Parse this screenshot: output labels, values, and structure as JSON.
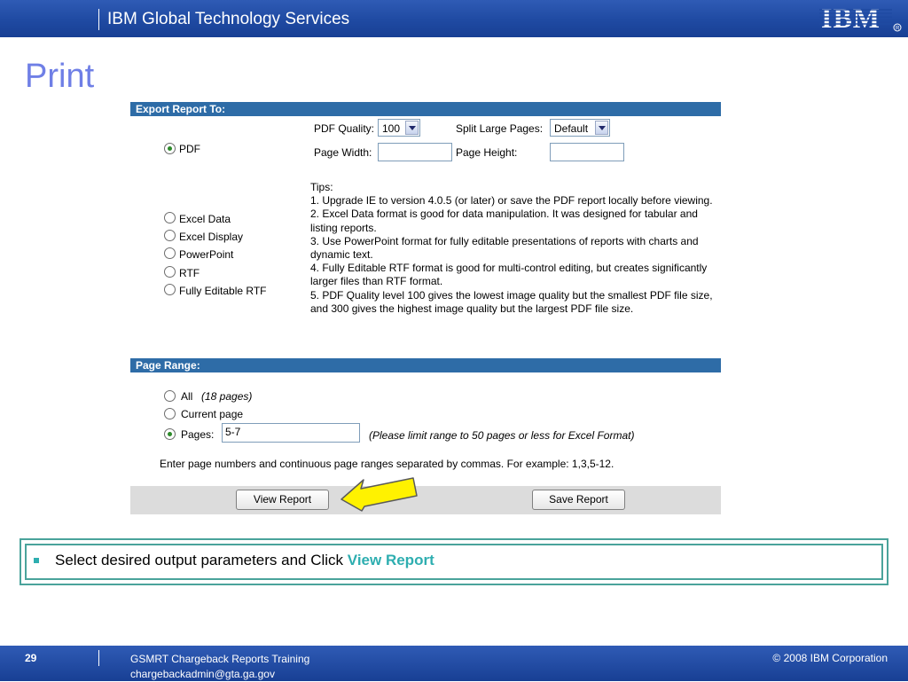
{
  "header": {
    "title": "IBM Global Technology Services",
    "logo_text": "IBM"
  },
  "slide": {
    "title": "Print"
  },
  "export": {
    "section_title": "Export Report To:",
    "formats": [
      {
        "label": "PDF",
        "selected": true
      },
      {
        "label": "Excel Data",
        "selected": false
      },
      {
        "label": "Excel Display",
        "selected": false
      },
      {
        "label": "PowerPoint",
        "selected": false
      },
      {
        "label": "RTF",
        "selected": false
      },
      {
        "label": "Fully Editable RTF",
        "selected": false
      }
    ],
    "pdf_quality_label": "PDF Quality:",
    "pdf_quality_value": "100",
    "split_pages_label": "Split Large Pages:",
    "split_pages_value": "Default",
    "page_width_label": "Page Width:",
    "page_width_value": "",
    "page_height_label": "Page Height:",
    "page_height_value": "",
    "tips": [
      "Tips:",
      "1. Upgrade IE to version 4.0.5 (or later) or save the PDF report locally before viewing.",
      "2. Excel Data format is good for data manipulation. It was designed for tabular and listing reports.",
      "3. Use PowerPoint format for fully editable presentations of reports with charts and dynamic text.",
      "4. Fully Editable RTF format is good for multi-control editing, but creates significantly larger files than RTF format.",
      "5. PDF Quality level 100 gives the lowest image quality but the smallest PDF file size, and 300 gives the highest image quality but the largest PDF file size."
    ]
  },
  "page_range": {
    "section_title": "Page Range:",
    "all_label": "All",
    "all_count": "(18 pages)",
    "current_label": "Current page",
    "pages_label": "Pages:",
    "pages_value": "5-7",
    "pages_note": "(Please limit range to 50 pages or less for Excel Format)",
    "selected": "pages",
    "help_text": "Enter page numbers and continuous page ranges separated by commas. For example: 1,3,5-12."
  },
  "buttons": {
    "view_report": "View Report",
    "save_report": "Save Report"
  },
  "note": {
    "text": "Select desired output parameters and Click ",
    "accent": "View Report",
    "accent_color": "#2eaeb0"
  },
  "footer": {
    "page_number": "29",
    "course": "GSMRT Chargeback Reports Training",
    "email": "chargebackadmin@gta.ga.gov",
    "copyright": "© 2008 IBM Corporation"
  },
  "colors": {
    "header_blue": "#1f4aa2",
    "section_bar": "#2e6ca7",
    "title": "#6f7fe6",
    "note_border": "#4aa39b"
  }
}
